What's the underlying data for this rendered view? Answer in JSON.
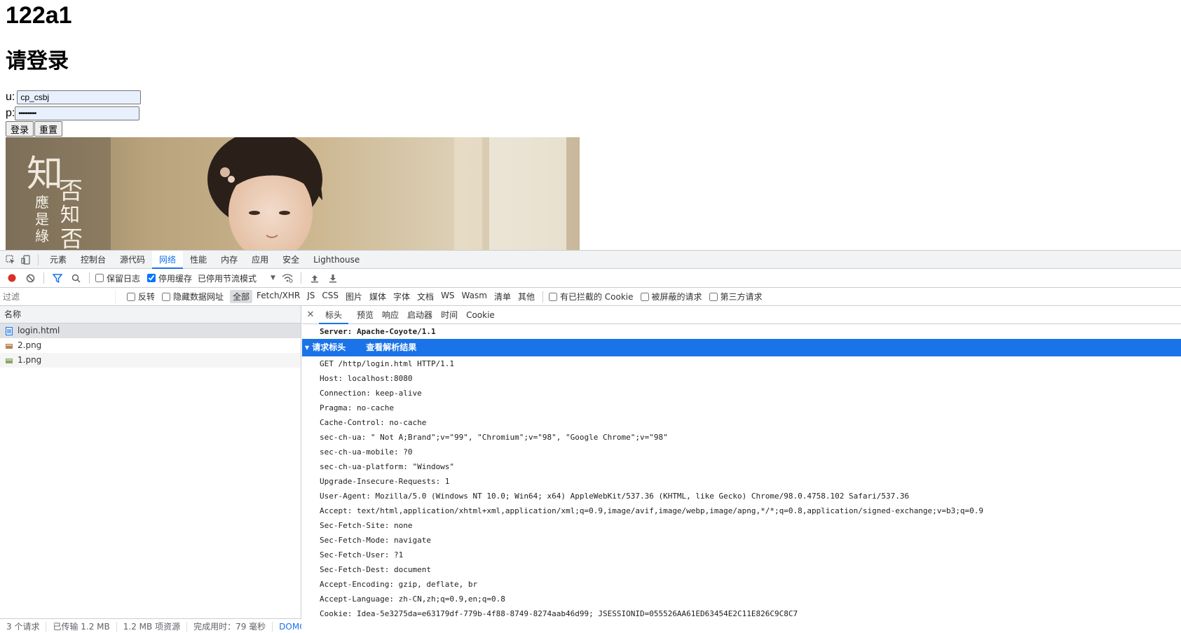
{
  "page": {
    "heading1": "122a1",
    "heading2": "请登录",
    "username_label": "u:",
    "username_value": "cp_csbj",
    "password_label": "p:",
    "password_value": "••••••••••",
    "login_button": "登录",
    "reset_button": "重置"
  },
  "devtools": {
    "tabs": [
      "元素",
      "控制台",
      "源代码",
      "网络",
      "性能",
      "内存",
      "应用",
      "安全",
      "Lighthouse"
    ],
    "active_tab": "网络",
    "toolbar": {
      "preserve_log": "保留日志",
      "disable_cache": "停用缓存",
      "throttle": "已停用节流模式"
    },
    "filter": {
      "placeholder": "过滤",
      "invert": "反转",
      "hide_data_urls": "隐藏数据网址",
      "types": [
        "全部",
        "Fetch/XHR",
        "JS",
        "CSS",
        "图片",
        "媒体",
        "字体",
        "文档",
        "WS",
        "Wasm",
        "清单",
        "其他"
      ],
      "blocked_cookies": "有已拦截的 Cookie",
      "blocked_requests": "被屏蔽的请求",
      "third_party": "第三方请求"
    },
    "requests": {
      "header": "名称",
      "items": [
        "login.html",
        "2.png",
        "1.png"
      ]
    },
    "status": {
      "requests": "3 个请求",
      "transferred": "已传输 1.2 MB",
      "resources": "1.2 MB 项资源",
      "finish": "完成用时：79 毫秒",
      "domc": "DOMCo"
    },
    "detail": {
      "tabs": [
        "标头",
        "预览",
        "响应",
        "启动器",
        "时间",
        "Cookie"
      ],
      "server_line": "Server: Apache-Coyote/1.1",
      "section_title": "▾ 请求标头",
      "section_link": "查看解析结果",
      "headers": [
        "GET /http/login.html HTTP/1.1",
        "Host: localhost:8080",
        "Connection: keep-alive",
        "Pragma: no-cache",
        "Cache-Control: no-cache",
        "sec-ch-ua: \" Not A;Brand\";v=\"99\", \"Chromium\";v=\"98\", \"Google Chrome\";v=\"98\"",
        "sec-ch-ua-mobile: ?0",
        "sec-ch-ua-platform: \"Windows\"",
        "Upgrade-Insecure-Requests: 1",
        "User-Agent: Mozilla/5.0 (Windows NT 10.0; Win64; x64) AppleWebKit/537.36 (KHTML, like Gecko) Chrome/98.0.4758.102 Safari/537.36",
        "Accept: text/html,application/xhtml+xml,application/xml;q=0.9,image/avif,image/webp,image/apng,*/*;q=0.8,application/signed-exchange;v=b3;q=0.9",
        "Sec-Fetch-Site: none",
        "Sec-Fetch-Mode: navigate",
        "Sec-Fetch-User: ?1",
        "Sec-Fetch-Dest: document",
        "Accept-Encoding: gzip, deflate, br",
        "Accept-Language: zh-CN,zh;q=0.9,en;q=0.8",
        "Cookie: Idea-5e3275da=e63179df-779b-4f88-8749-8274aab46d99; JSESSIONID=055526AA61ED63454E2C11E826C9C8C7"
      ]
    }
  },
  "colors": {
    "accent": "#1a73e8",
    "record": "#d93025"
  }
}
